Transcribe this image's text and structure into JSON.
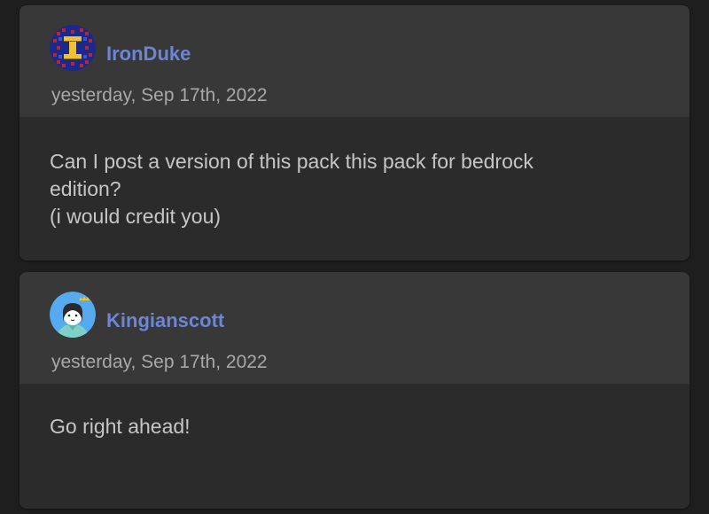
{
  "comments": [
    {
      "username": "IronDuke",
      "timestamp": "yesterday, Sep 17th, 2022",
      "body": "Can I post a version of this pack this pack for bedrock\nedition?\n(i would credit you)"
    },
    {
      "username": "Kingianscott",
      "timestamp": "yesterday, Sep 17th, 2022",
      "body": "Go right ahead!"
    }
  ],
  "colors": {
    "background": "#1e1e1e",
    "card": "#2b2b2c",
    "card_header": "#383839",
    "username": "#6c85d4",
    "timestamp": "#a8a8a8",
    "body_text": "#c6c6c6"
  },
  "icons": [
    "irondtuke-avatar-icon",
    "kingianscott-avatar-icon"
  ]
}
